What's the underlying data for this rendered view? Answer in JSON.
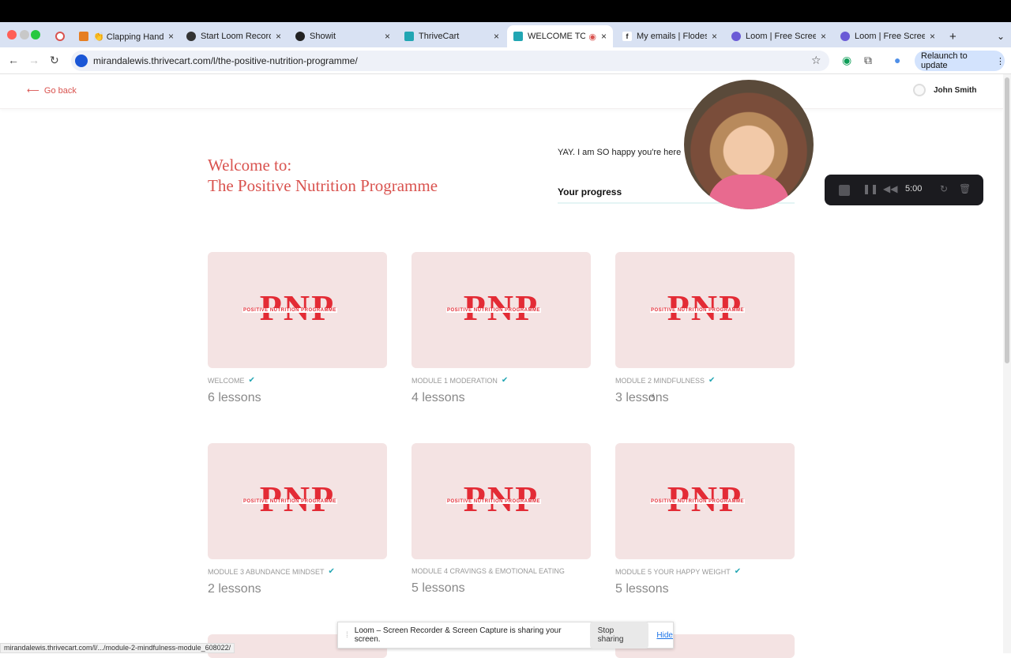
{
  "browser": {
    "tabs": [
      {
        "label": "",
        "icon": "record-icon"
      },
      {
        "label": "👏 Clapping Hands",
        "icon": "shield-icon"
      },
      {
        "label": "Start Loom Recordi",
        "icon": "loom-icon"
      },
      {
        "label": "Showit",
        "icon": "showit-icon"
      },
      {
        "label": "ThriveCart",
        "icon": "thrivecart-icon"
      },
      {
        "label": "WELCOME TO T",
        "icon": "thrivecart-icon"
      },
      {
        "label": "My emails | Flodesk",
        "icon": "facebook-icon"
      },
      {
        "label": "Loom | Free Screen",
        "icon": "loom-icon"
      },
      {
        "label": "Loom | Free Screen",
        "icon": "loom-icon"
      }
    ],
    "url": "mirandalewis.thrivecart.com/l/the-positive-nutrition-programme/",
    "relaunch_label": "Relaunch to update",
    "status_url": "mirandalewis.thrivecart.com/l/.../module-2-mindfulness-module_608022/"
  },
  "header": {
    "go_back": "Go back",
    "user_name": "John Smith"
  },
  "hero": {
    "title_line1": "Welcome to:",
    "title_line2": "The Positive Nutrition Programme",
    "yay": "YAY. I am SO happy you're here",
    "progress_label": "Your progress"
  },
  "modules": [
    {
      "name": "WELCOME",
      "lessons": "6 lessons",
      "complete": true
    },
    {
      "name": "MODULE 1 MODERATION",
      "lessons": "4 lessons",
      "complete": true
    },
    {
      "name": "MODULE 2 MINDFULNESS",
      "lessons": "3 lessons",
      "complete": true
    },
    {
      "name": "MODULE 3 ABUNDANCE MINDSET",
      "lessons": "2 lessons",
      "complete": true
    },
    {
      "name": "MODULE 4 CRAVINGS & EMOTIONAL EATING",
      "lessons": "5 lessons",
      "complete": false
    },
    {
      "name": "MODULE 5 YOUR HAPPY WEIGHT",
      "lessons": "5 lessons",
      "complete": true
    }
  ],
  "logo": {
    "letters": "PNP",
    "subtitle": "POSITIVE NUTRITION PROGRAMME"
  },
  "loom": {
    "timer": "5:00",
    "share_message": "Loom – Screen Recorder & Screen Capture is sharing your screen.",
    "stop_label": "Stop sharing",
    "hide_label": "Hide"
  },
  "colors": {
    "accent": "#d9534f",
    "logo_red": "#e32b35",
    "check": "#22a6b3",
    "card_bg": "#f4e3e3"
  }
}
